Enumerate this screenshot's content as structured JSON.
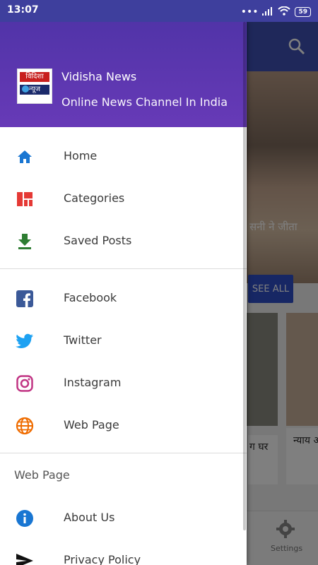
{
  "status_bar": {
    "time": "13:07",
    "battery": "59"
  },
  "drawer": {
    "header": {
      "logo_line1": "विदिशा",
      "logo_line2": "न्यूज",
      "app_name": "Vidisha News",
      "tagline": "Online News Channel In India"
    },
    "main_items": [
      {
        "label": "Home",
        "icon": "home-icon"
      },
      {
        "label": "Categories",
        "icon": "categories-icon"
      },
      {
        "label": "Saved Posts",
        "icon": "download-icon"
      }
    ],
    "social_items": [
      {
        "label": "Facebook",
        "icon": "facebook-icon"
      },
      {
        "label": "Twitter",
        "icon": "twitter-icon"
      },
      {
        "label": "Instagram",
        "icon": "instagram-icon"
      },
      {
        "label": "Web Page",
        "icon": "globe-icon"
      }
    ],
    "section_title": "Web Page",
    "page_items": [
      {
        "label": "About Us",
        "icon": "info-icon"
      },
      {
        "label": "Privacy Policy",
        "icon": "send-icon"
      }
    ]
  },
  "background": {
    "hero_caption": "सनी ने जीता",
    "see_all": "SEE ALL",
    "card1_text": "ग घर",
    "card2_text": "न्याय अर्थव का क",
    "settings_label": "Settings"
  },
  "colors": {
    "header_purple": "#673ab7",
    "status_bar": "#3e3f9d",
    "home_blue": "#1976d2",
    "categories_red": "#e53935",
    "saved_green": "#2e7d32",
    "facebook_blue": "#3b5998",
    "twitter_blue": "#1da1f2",
    "instagram_pink": "#c13584",
    "web_orange": "#ef6c00"
  }
}
